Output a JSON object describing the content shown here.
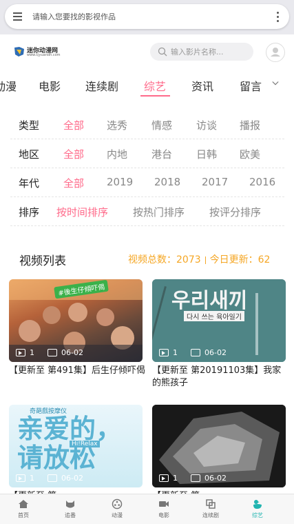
{
  "browser": {
    "search_placeholder": "请输入您要找的影视作品"
  },
  "site": {
    "logo_text": "迷你动漫网",
    "logo_sub": "www.cjyuandh.com",
    "search_placeholder": "输入影片名称...",
    "accent_color": "#ff6a8a",
    "stats_color": "#f5a623"
  },
  "nav": {
    "tabs": [
      "动漫",
      "电影",
      "连续剧",
      "综艺",
      "资讯",
      "留言"
    ],
    "active": "综艺"
  },
  "filters": [
    {
      "label": "类型",
      "options": [
        "全部",
        "选秀",
        "情感",
        "访谈",
        "播报"
      ],
      "active": "全部"
    },
    {
      "label": "地区",
      "options": [
        "全部",
        "内地",
        "港台",
        "日韩",
        "欧美"
      ],
      "active": "全部"
    },
    {
      "label": "年代",
      "options": [
        "全部",
        "2019",
        "2018",
        "2017",
        "2016"
      ],
      "active": "全部"
    },
    {
      "label": "排序",
      "options": [
        "按时间排序",
        "按热门排序",
        "按评分排序"
      ],
      "active": "按时间排序"
    }
  ],
  "list": {
    "title": "视频列表",
    "total_text": "视频总数：2073",
    "today_text": "今日更新：62"
  },
  "videos": [
    {
      "title": "【更新至 第491集】后生仔倾吓偈",
      "count": "1",
      "date": "06-02",
      "thumb_text": "#後生仔傾吓偈"
    },
    {
      "title": "【更新至 第20191103集】我家的熊孩子",
      "count": "1",
      "date": "06-02",
      "thumb_text": "우리새끼",
      "thumb_sub": "다시 쓰는 육아일기"
    },
    {
      "title": "【更新至 第",
      "count": "1",
      "date": "06-02",
      "thumb_text": "亲爱的，请放松",
      "thumb_top": "奇葩戲按摩仪",
      "thumb_mid": "Hi!Relax"
    },
    {
      "title": "【更新至 第",
      "count": "1",
      "date": "06-02"
    }
  ],
  "bottom_nav": {
    "items": [
      "首页",
      "追番",
      "动漫",
      "电影",
      "连续剧",
      "综艺"
    ],
    "active": "综艺",
    "active_color": "#21b4b0"
  }
}
